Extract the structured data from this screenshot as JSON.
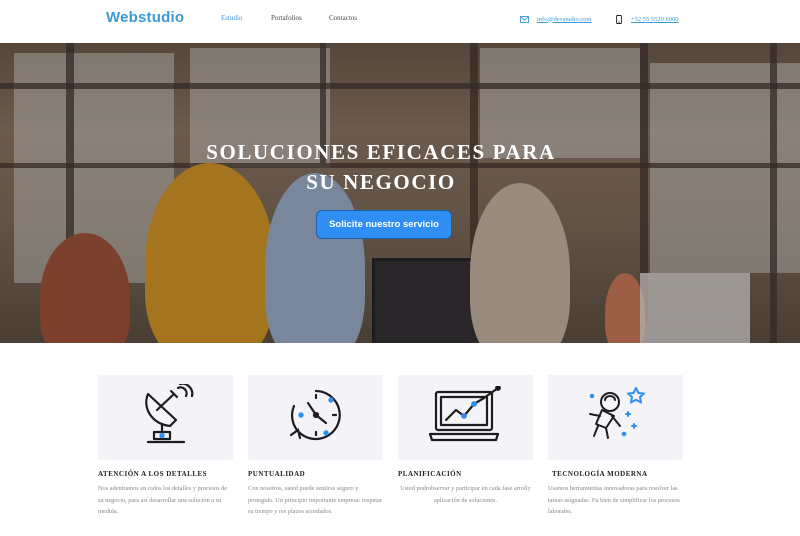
{
  "header": {
    "logo": "Webstudio",
    "nav": [
      "Estudio",
      "Portafolios",
      "Contactos"
    ],
    "email": "info@devstudio.com",
    "phone": "+52 55 5529 6000"
  },
  "hero": {
    "title_line1": "SOLUCIONES EFICACES PARA",
    "title_line2": "SU NEGOCIO",
    "cta": "Solicite nuestro servicio"
  },
  "features": [
    {
      "icon": "satellite-dish-icon",
      "title": "ATENCIÓN A LOS DETALLES",
      "desc": "Nos adentramos en todos los detalles y procesos de su negocio, para así desarrollar una solución a su medida."
    },
    {
      "icon": "clock-icon",
      "title": "PUNTUALIDAD",
      "desc": "Con nosotros, usted puede sentirse seguro y protegido. Un principio importante empresa: respetar su tiempo y res plazos acordados."
    },
    {
      "icon": "laptop-chart-icon",
      "title": "PLANIFICACIÓN",
      "desc": "Usted podrobservar y participar en cada fase arrolly aplicación de soluciones."
    },
    {
      "icon": "astronaut-icon",
      "title": "TECNOLOGÍA MODERNA",
      "desc": "Usamos herramientas innovadoras para resolver las tareas asignadas. Fu bien de simplificar los procesos laborales."
    }
  ],
  "colors": {
    "accent": "#3a9ad9",
    "button": "#2f8ef2",
    "card": "#f3f3f8"
  }
}
